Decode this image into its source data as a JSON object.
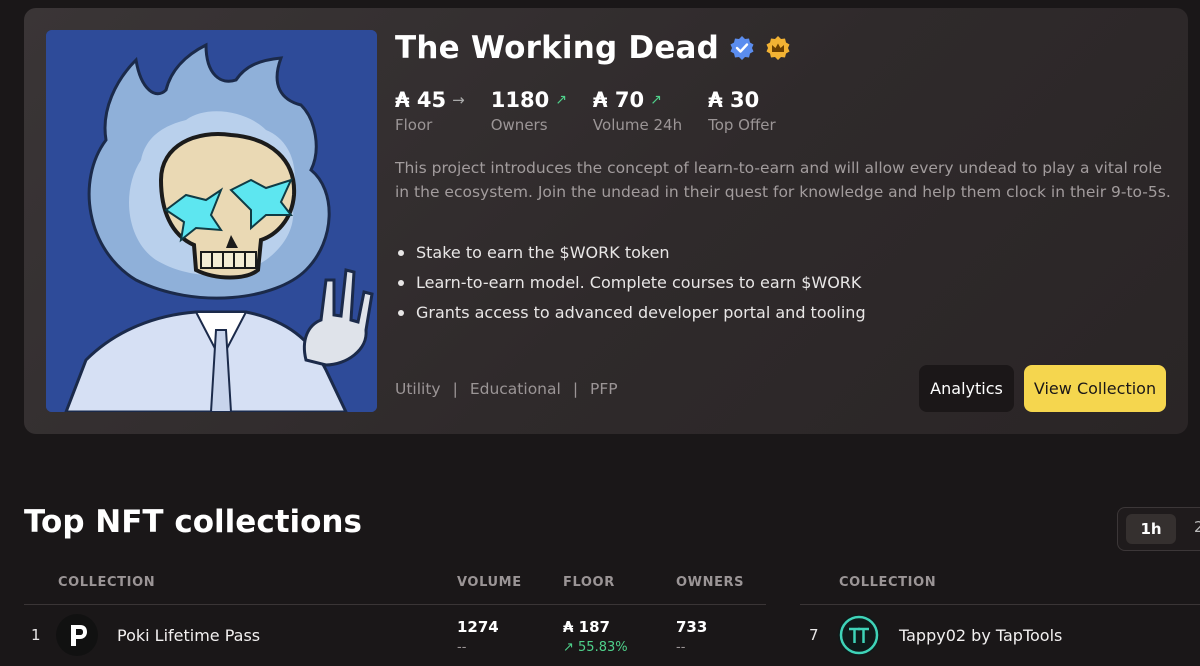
{
  "hero": {
    "title": "The Working Dead",
    "stats": [
      {
        "value": "₳ 45",
        "label": "Floor",
        "trend": "→"
      },
      {
        "value": "1180",
        "label": "Owners",
        "trend": "↗"
      },
      {
        "value": "₳ 70",
        "label": "Volume 24h",
        "trend": "↗"
      },
      {
        "value": "₳ 30",
        "label": "Top Offer",
        "trend": ""
      }
    ],
    "description": "This project introduces the concept of learn-to-earn and will allow every undead to play a vital role in the ecosystem. Join the undead in their quest for knowledge and help them clock in their 9-to-5s.",
    "bullets": [
      "Stake to earn the $WORK token",
      "Learn-to-earn model. Complete courses to earn $WORK",
      "Grants access to advanced developer portal and tooling"
    ],
    "tags": [
      "Utility",
      "Educational",
      "PFP"
    ],
    "analytics_label": "Analytics",
    "view_label": "View Collection"
  },
  "top": {
    "title": "Top NFT collections",
    "time_options": [
      "1h",
      "2"
    ],
    "headers_left": {
      "collection": "COLLECTION",
      "volume": "VOLUME",
      "floor": "FLOOR",
      "owners": "OWNERS"
    },
    "headers_right": {
      "collection": "COLLECTION"
    },
    "rows_left": [
      {
        "rank": "1",
        "name": "Poki Lifetime Pass",
        "volume": "1274",
        "volume_change": "--",
        "floor": "₳ 187",
        "floor_change": "↗ 55.83%",
        "owners": "733",
        "owners_change": "--"
      }
    ],
    "rows_right": [
      {
        "rank": "7",
        "name": "Tappy02 by TapTools"
      }
    ]
  },
  "colors": {
    "accent_yellow": "#f5d64e",
    "positive_green": "#4fd18b",
    "verified_blue": "#5b8def",
    "crown_gold": "#f2b233"
  }
}
